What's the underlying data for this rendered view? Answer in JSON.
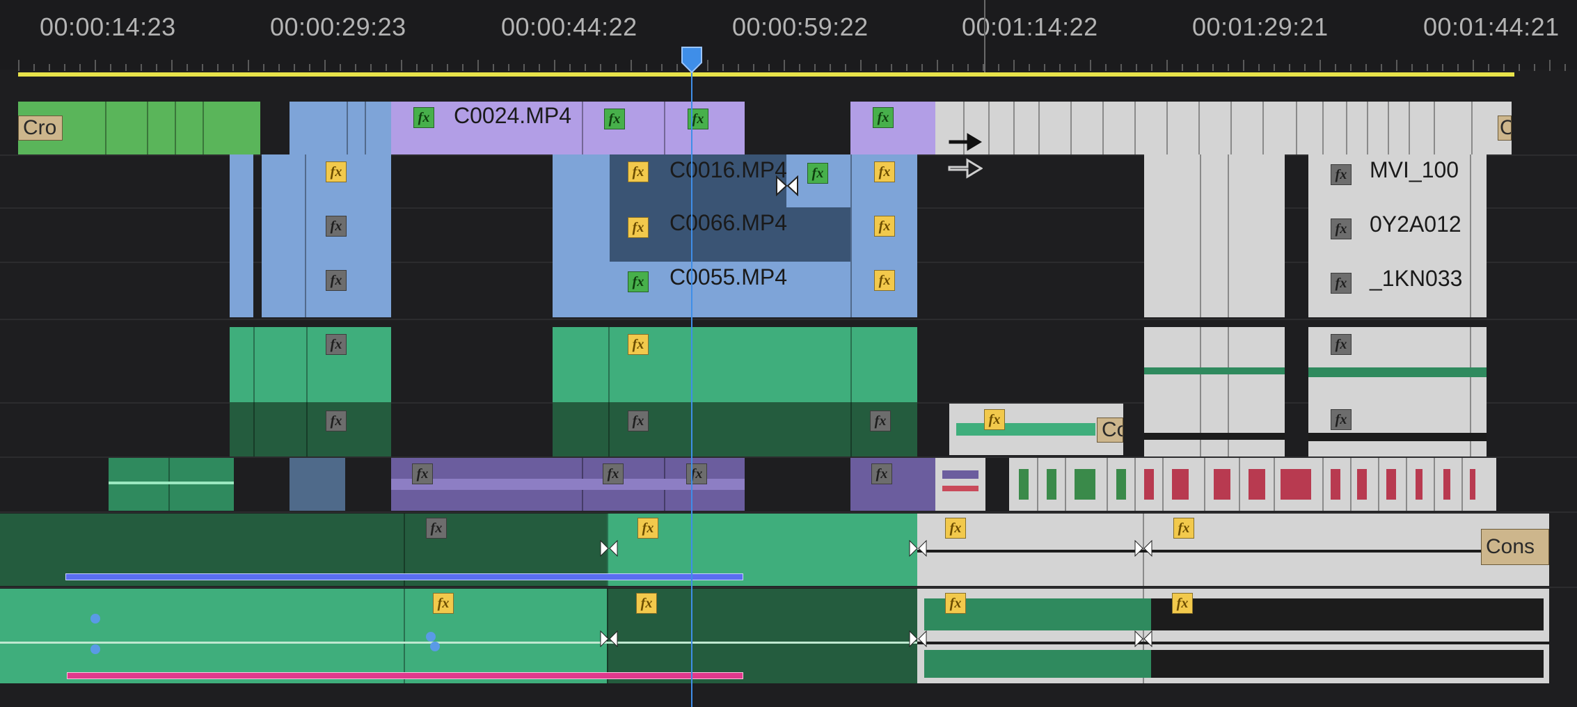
{
  "ruler": {
    "timecodes": [
      "00:00:14:23",
      "00:00:29:23",
      "00:00:44:22",
      "00:00:59:22",
      "00:01:14:22",
      "00:01:29:21",
      "00:01:44:21"
    ]
  },
  "clips": {
    "c0024": "C0024.MP4",
    "c0016": "C0016.MP4",
    "c0066": "C0066.MP4",
    "c0055": "C0055.MP4",
    "mvi": "MVI_100",
    "oy2a": "0Y2A012",
    "ikn": "_1KN033",
    "cro": "Cro",
    "c_right": "C",
    "co_audio": "Co",
    "cons": "Cons"
  },
  "effect_badge_text": "fx",
  "colors": {
    "video_green": "#5ab55a",
    "video_blue": "#7ea4d8",
    "video_purple": "#b29ee6",
    "video_gray": "#d2d2d2",
    "audio_green": "#2f7a55",
    "audio_purple": "#6b5d9e",
    "work_area_bar": "#e8e34a",
    "playhead": "#3f8ee8"
  },
  "icons": [
    "playhead-icon",
    "fx-badge-icon",
    "transition-icon",
    "keyframe-icon",
    "selection-arrow-icon",
    "trim-cursor-icon"
  ]
}
